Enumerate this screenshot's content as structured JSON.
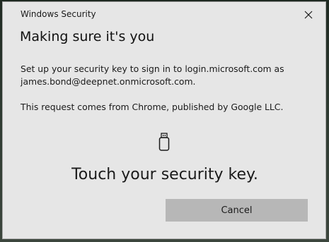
{
  "window": {
    "title": "Windows Security"
  },
  "dialog": {
    "heading": "Making sure it's you",
    "description": "Set up your security key to sign in to login.microsoft.com as james.bond@deepnet.onmicrosoft.com.",
    "origin": "This request comes from Chrome, published by Google LLC.",
    "instruction": "Touch your security key.",
    "icon": "usb-security-key-icon"
  },
  "buttons": {
    "cancel_label": "Cancel",
    "close_icon": "close-icon"
  },
  "colors": {
    "dialog_background": "#e6e6e6",
    "button_background": "#b7b7b7",
    "text": "#1a1a1a"
  }
}
